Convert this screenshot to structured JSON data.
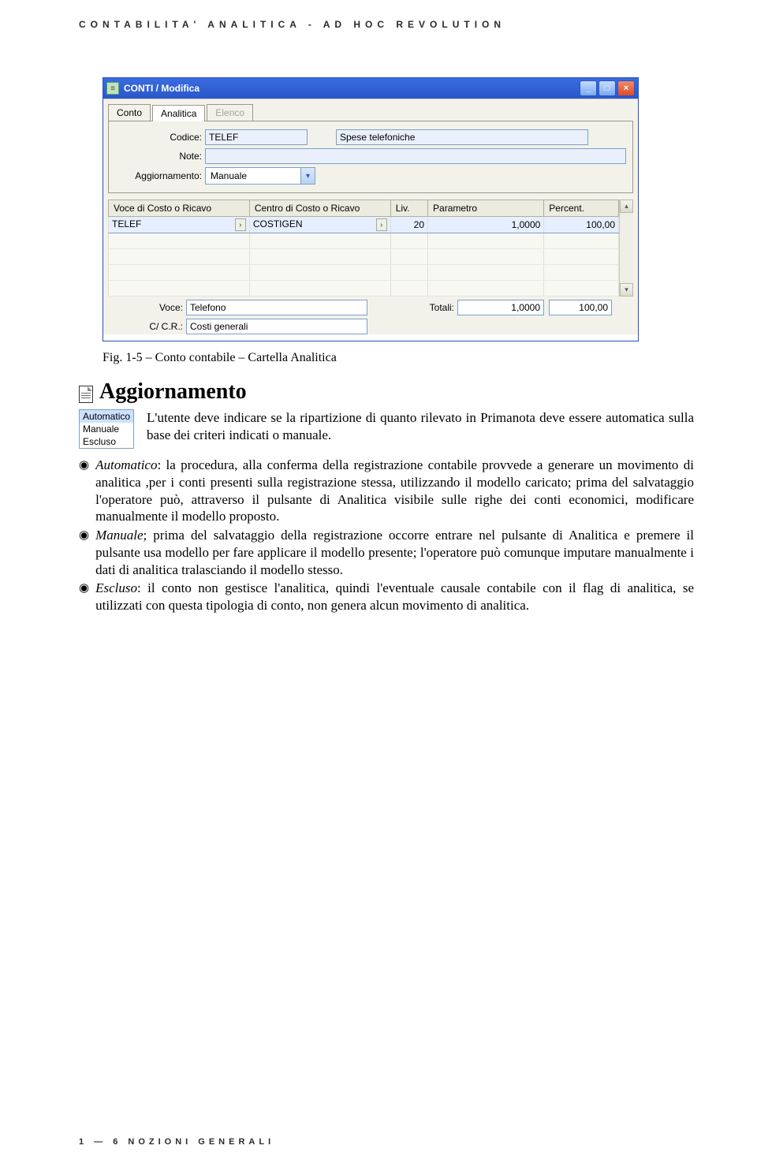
{
  "page": {
    "header": "CONTABILITA' ANALITICA - AD HOC REVOLUTION",
    "footer": "1 — 6   NOZIONI GENERALI"
  },
  "caption": "Fig. 1-5 – Conto contabile – Cartella Analitica",
  "section_title": "Aggiornamento",
  "intro_paragraph": "L'utente deve indicare se la ripartizione di quanto rilevato in Primanota deve essere automatica sulla base dei criteri indicati o manuale.",
  "listbox": {
    "items": [
      "Automatico",
      "Manuale",
      "Escluso"
    ],
    "selected_index": 0
  },
  "bullets": [
    {
      "lead": "Automatico",
      "text": ": la procedura, alla conferma della registrazione contabile provvede a generare un movimento di analitica ,per i conti presenti sulla registrazione stessa, utilizzando il modello caricato; prima del salvataggio l'operatore può, attraverso il pulsante di Analitica visibile sulle righe dei conti economici, modificare manualmente il modello proposto."
    },
    {
      "lead": "Manuale",
      "text": "; prima del salvataggio della registrazione occorre entrare nel pulsante di Analitica e premere il pulsante usa modello per fare applicare il modello presente; l'operatore può comunque imputare manualmente i dati di analitica tralasciando il modello stesso."
    },
    {
      "lead": "Escluso",
      "text": ": il conto non gestisce l'analitica, quindi l'eventuale causale contabile con il flag di analitica, se utilizzati con questa tipologia di conto, non genera alcun movimento di analitica."
    }
  ],
  "window": {
    "title": "CONTI / Modifica",
    "tabs": {
      "t0": "Conto",
      "t1": "Analitica",
      "t2": "Elenco"
    },
    "labels": {
      "codice": "Codice:",
      "note": "Note:",
      "aggiornamento": "Aggiornamento:",
      "voce": "Voce:",
      "totali": "Totali:",
      "ccr": "C/ C.R.:"
    },
    "fields": {
      "codice": "TELEF",
      "codice_desc": "Spese telefoniche",
      "note": "",
      "aggiornamento": "Manuale",
      "voce": "Telefono",
      "ccr": "Costi generali",
      "tot_param": "1,0000",
      "tot_percent": "100,00"
    },
    "grid": {
      "headers": {
        "voce": "Voce di Costo o Ricavo",
        "centro": "Centro di Costo o Ricavo",
        "liv": "Liv.",
        "param": "Parametro",
        "percent": "Percent."
      },
      "rows": [
        {
          "voce": "TELEF",
          "centro": "COSTIGEN",
          "liv": "20",
          "param": "1,0000",
          "percent": "100,00"
        }
      ]
    }
  }
}
